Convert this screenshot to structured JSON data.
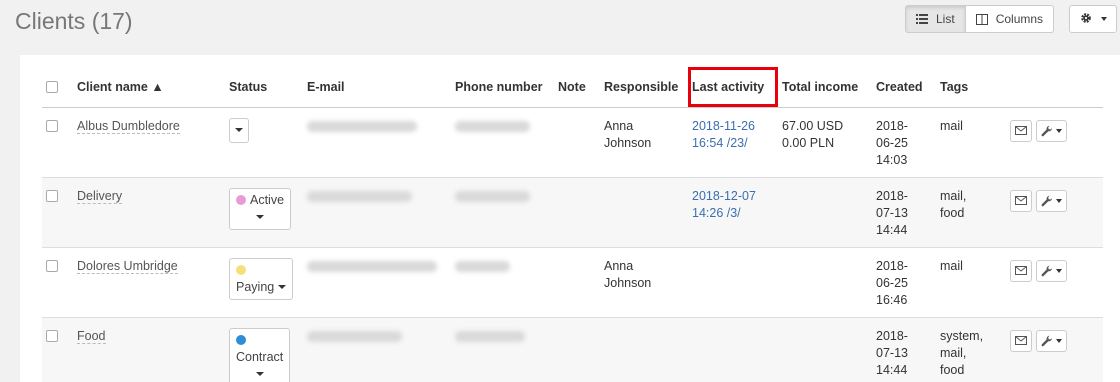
{
  "page": {
    "title": "Clients (17)"
  },
  "view_toggle": {
    "list_label": "List",
    "columns_label": "Columns"
  },
  "table": {
    "headers": {
      "client_name": "Client name ▲",
      "status": "Status",
      "email": "E-mail",
      "phone": "Phone number",
      "note": "Note",
      "responsible": "Responsible",
      "last_activity": "Last activity",
      "total_income": "Total income",
      "created": "Created",
      "tags": "Tags"
    },
    "rows": [
      {
        "name": "Albus Dumbledore",
        "status": "",
        "status_color": "",
        "responsible": [
          "Anna",
          "Johnson"
        ],
        "activity": [
          "2018-11-26",
          "16:54 /23/"
        ],
        "income": [
          "67.00 USD",
          "0.00 PLN"
        ],
        "created": [
          "2018-",
          "06-25",
          "14:03"
        ],
        "tags": [
          "mail"
        ]
      },
      {
        "name": "Delivery",
        "status": "Active",
        "status_color": "#e99bd8",
        "responsible": [],
        "activity": [
          "2018-12-07",
          "14:26 /3/"
        ],
        "income": [],
        "created": [
          "2018-",
          "07-13",
          "14:44"
        ],
        "tags": [
          "mail,",
          "food"
        ]
      },
      {
        "name": "Dolores Umbridge",
        "status": "Paying",
        "status_color": "#f3e07a",
        "responsible": [
          "Anna",
          "Johnson"
        ],
        "activity": [],
        "income": [],
        "created": [
          "2018-",
          "06-25",
          "16:46"
        ],
        "tags": [
          "mail"
        ]
      },
      {
        "name": "Food",
        "status": "Contract",
        "status_color": "#2c8fd6",
        "responsible": [],
        "activity": [],
        "income": [],
        "created": [
          "2018-",
          "07-13",
          "14:44"
        ],
        "tags": [
          "system,",
          "mail,",
          "food"
        ]
      }
    ]
  },
  "colors": {
    "highlight": "#e8000b",
    "link": "#3a6fb0"
  },
  "icons": [
    "list-icon",
    "columns-icon",
    "gear-icon",
    "envelope-icon",
    "wrench-icon"
  ]
}
